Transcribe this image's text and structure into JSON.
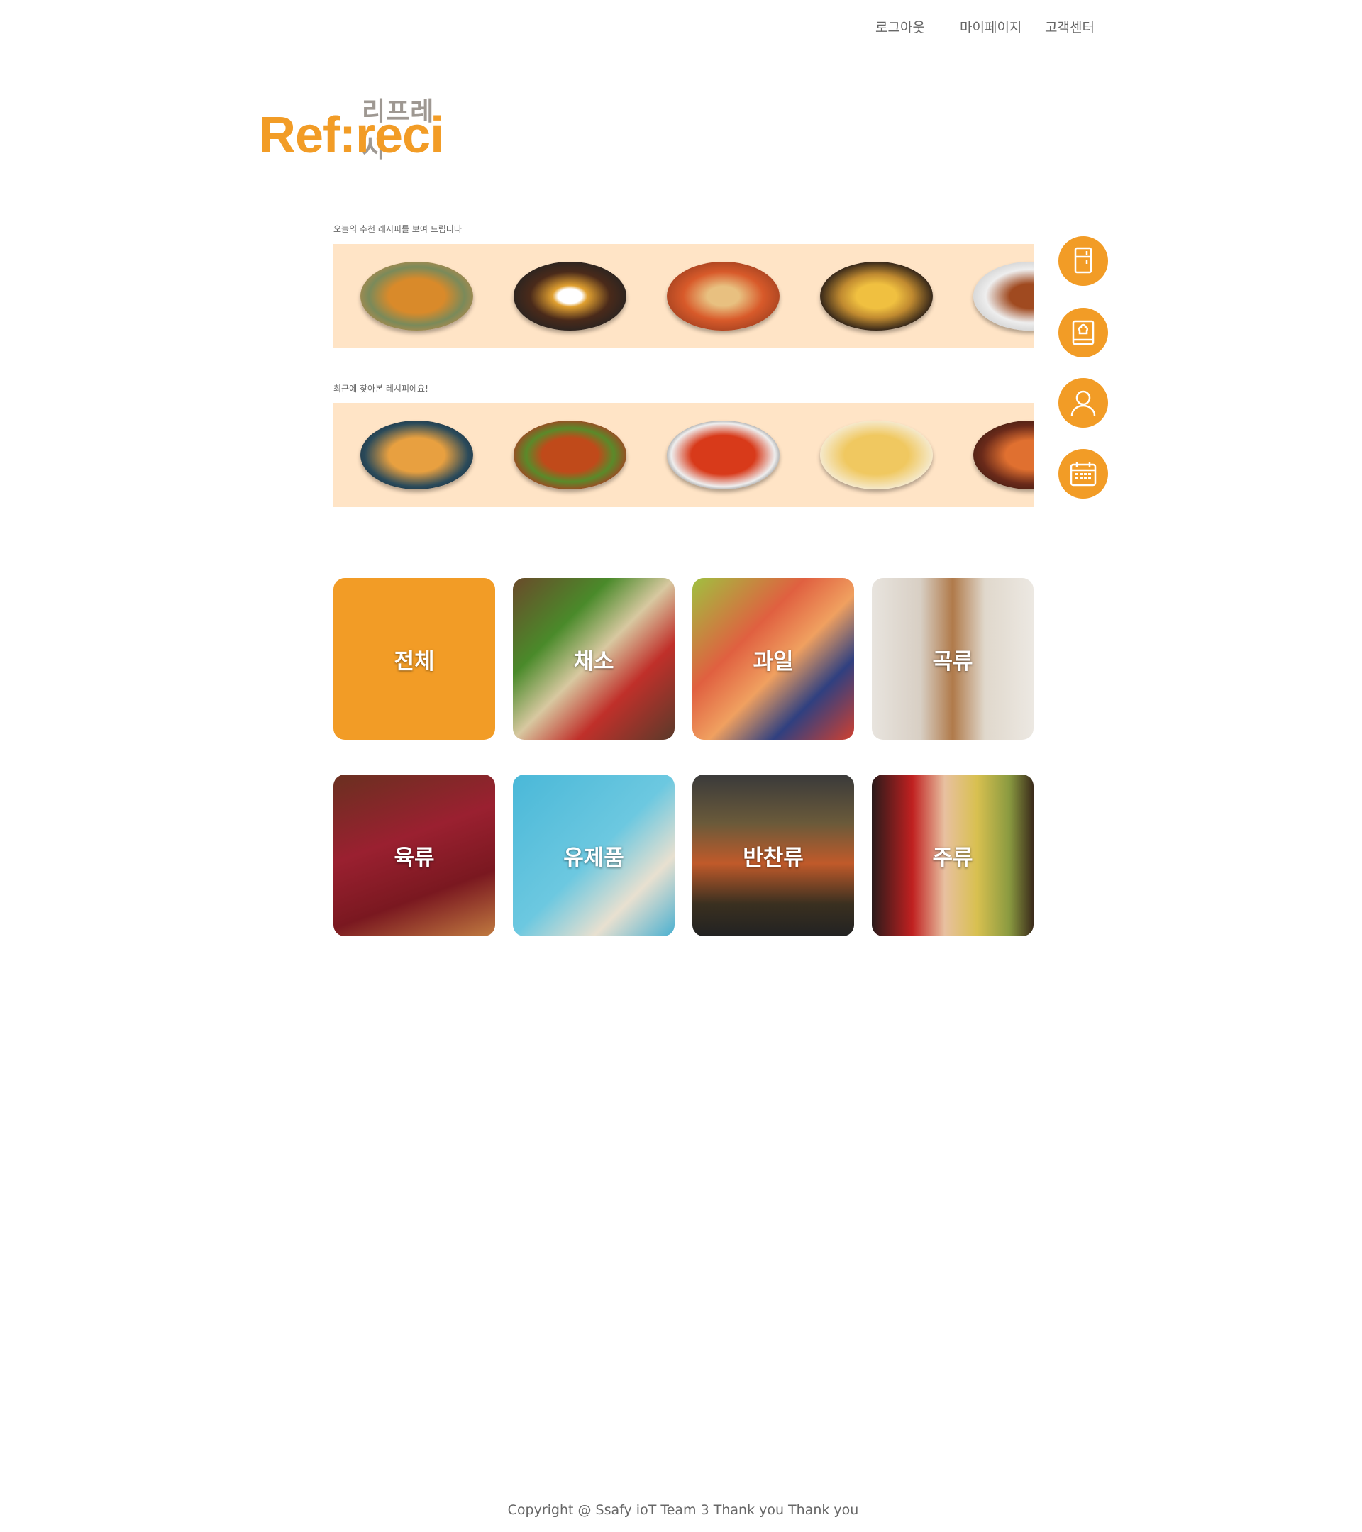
{
  "nav": {
    "logout": "로그아웃",
    "mypage": "마이페이지",
    "support": "고객센터"
  },
  "logo": {
    "korean": "리프레시",
    "english": "Ref:reci"
  },
  "today": {
    "label": "오늘의 추천 레시피를 보여 드립니다"
  },
  "recent": {
    "label": "최근에 찾아본 레시피에요!"
  },
  "side_buttons": [
    "fridge-icon",
    "recipe-book-icon",
    "user-icon",
    "calendar-icon"
  ],
  "categories": [
    "전체",
    "채소",
    "과일",
    "곡류",
    "육류",
    "유제품",
    "반찬류",
    "주류"
  ],
  "footer": "Copyright @ Ssafy ioT Team 3 Thank you Thank you",
  "colors": {
    "accent": "#f29c26",
    "band": "#ffe4c6"
  }
}
